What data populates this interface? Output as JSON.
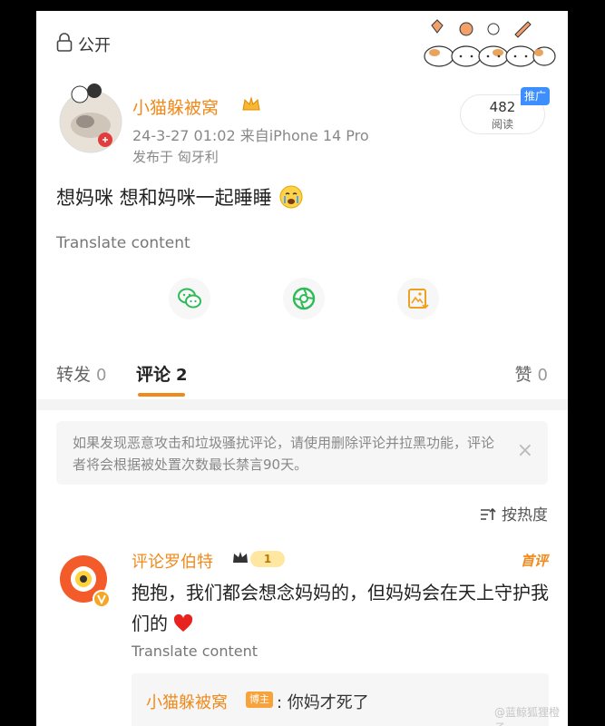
{
  "header": {
    "visibility_label": "公开"
  },
  "post": {
    "username": "小猫躲被窝",
    "datetime_source": "24-3-27 01:02  来自iPhone 14 Pro",
    "location": "发布于 匈牙利",
    "reads_count": "482",
    "reads_label": "阅读",
    "promo_label": "推广",
    "text": "想妈咪 想和妈咪一起睡睡",
    "translate_label": "Translate content"
  },
  "tabs": [
    {
      "label": "转发",
      "count": "0"
    },
    {
      "label": "评论",
      "count": "2"
    },
    {
      "label": "赞",
      "count": "0"
    }
  ],
  "notice": {
    "text": "如果发现恶意攻击和垃圾骚扰评论，请使用删除评论并拉黑功能，评论者将会根据被处置次数最长禁言90天。",
    "close_symbol": "×"
  },
  "sort": {
    "label": "按热度"
  },
  "comment": {
    "username": "评论罗伯特",
    "level": "1",
    "first_badge": "首评",
    "text": "抱抱，我们都会想念妈妈的，但妈妈会在天上守护我们的",
    "translate_label": "Translate content",
    "reply": {
      "username": "小猫躲被窝",
      "badge": "博主",
      "text": ": 你妈才死了"
    }
  },
  "watermark": {
    "text": "@蓝鲸狐狸橙子"
  },
  "colors": {
    "accent": "#f08a1c",
    "badge_blue": "#3d8eff",
    "muted_text": "#888888",
    "notice_bg": "#f6f6f6"
  }
}
